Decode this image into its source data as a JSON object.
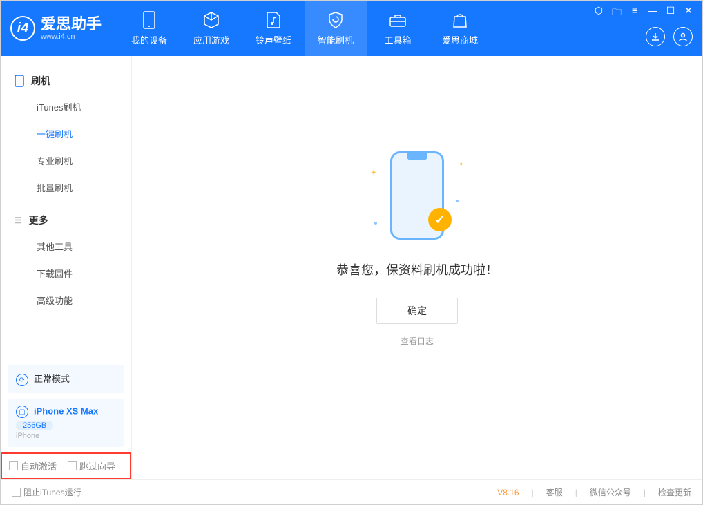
{
  "app": {
    "name": "爱思助手",
    "url": "www.i4.cn"
  },
  "nav": {
    "tabs": [
      "我的设备",
      "应用游戏",
      "铃声壁纸",
      "智能刷机",
      "工具箱",
      "爱思商城"
    ],
    "activeIndex": 3
  },
  "sidebar": {
    "group1": {
      "title": "刷机",
      "items": [
        "iTunes刷机",
        "一键刷机",
        "专业刷机",
        "批量刷机"
      ],
      "selectedIndex": 1
    },
    "group2": {
      "title": "更多",
      "items": [
        "其他工具",
        "下载固件",
        "高级功能"
      ]
    },
    "modeCard": {
      "label": "正常模式"
    },
    "deviceCard": {
      "name": "iPhone XS Max",
      "storage": "256GB",
      "type": "iPhone"
    },
    "options": {
      "opt1": "自动激活",
      "opt2": "跳过向导"
    }
  },
  "main": {
    "successText": "恭喜您，保资料刷机成功啦！",
    "okBtn": "确定",
    "logLink": "查看日志"
  },
  "footer": {
    "blockItunes": "阻止iTunes运行",
    "version": "V8.16",
    "links": [
      "客服",
      "微信公众号",
      "检查更新"
    ]
  }
}
